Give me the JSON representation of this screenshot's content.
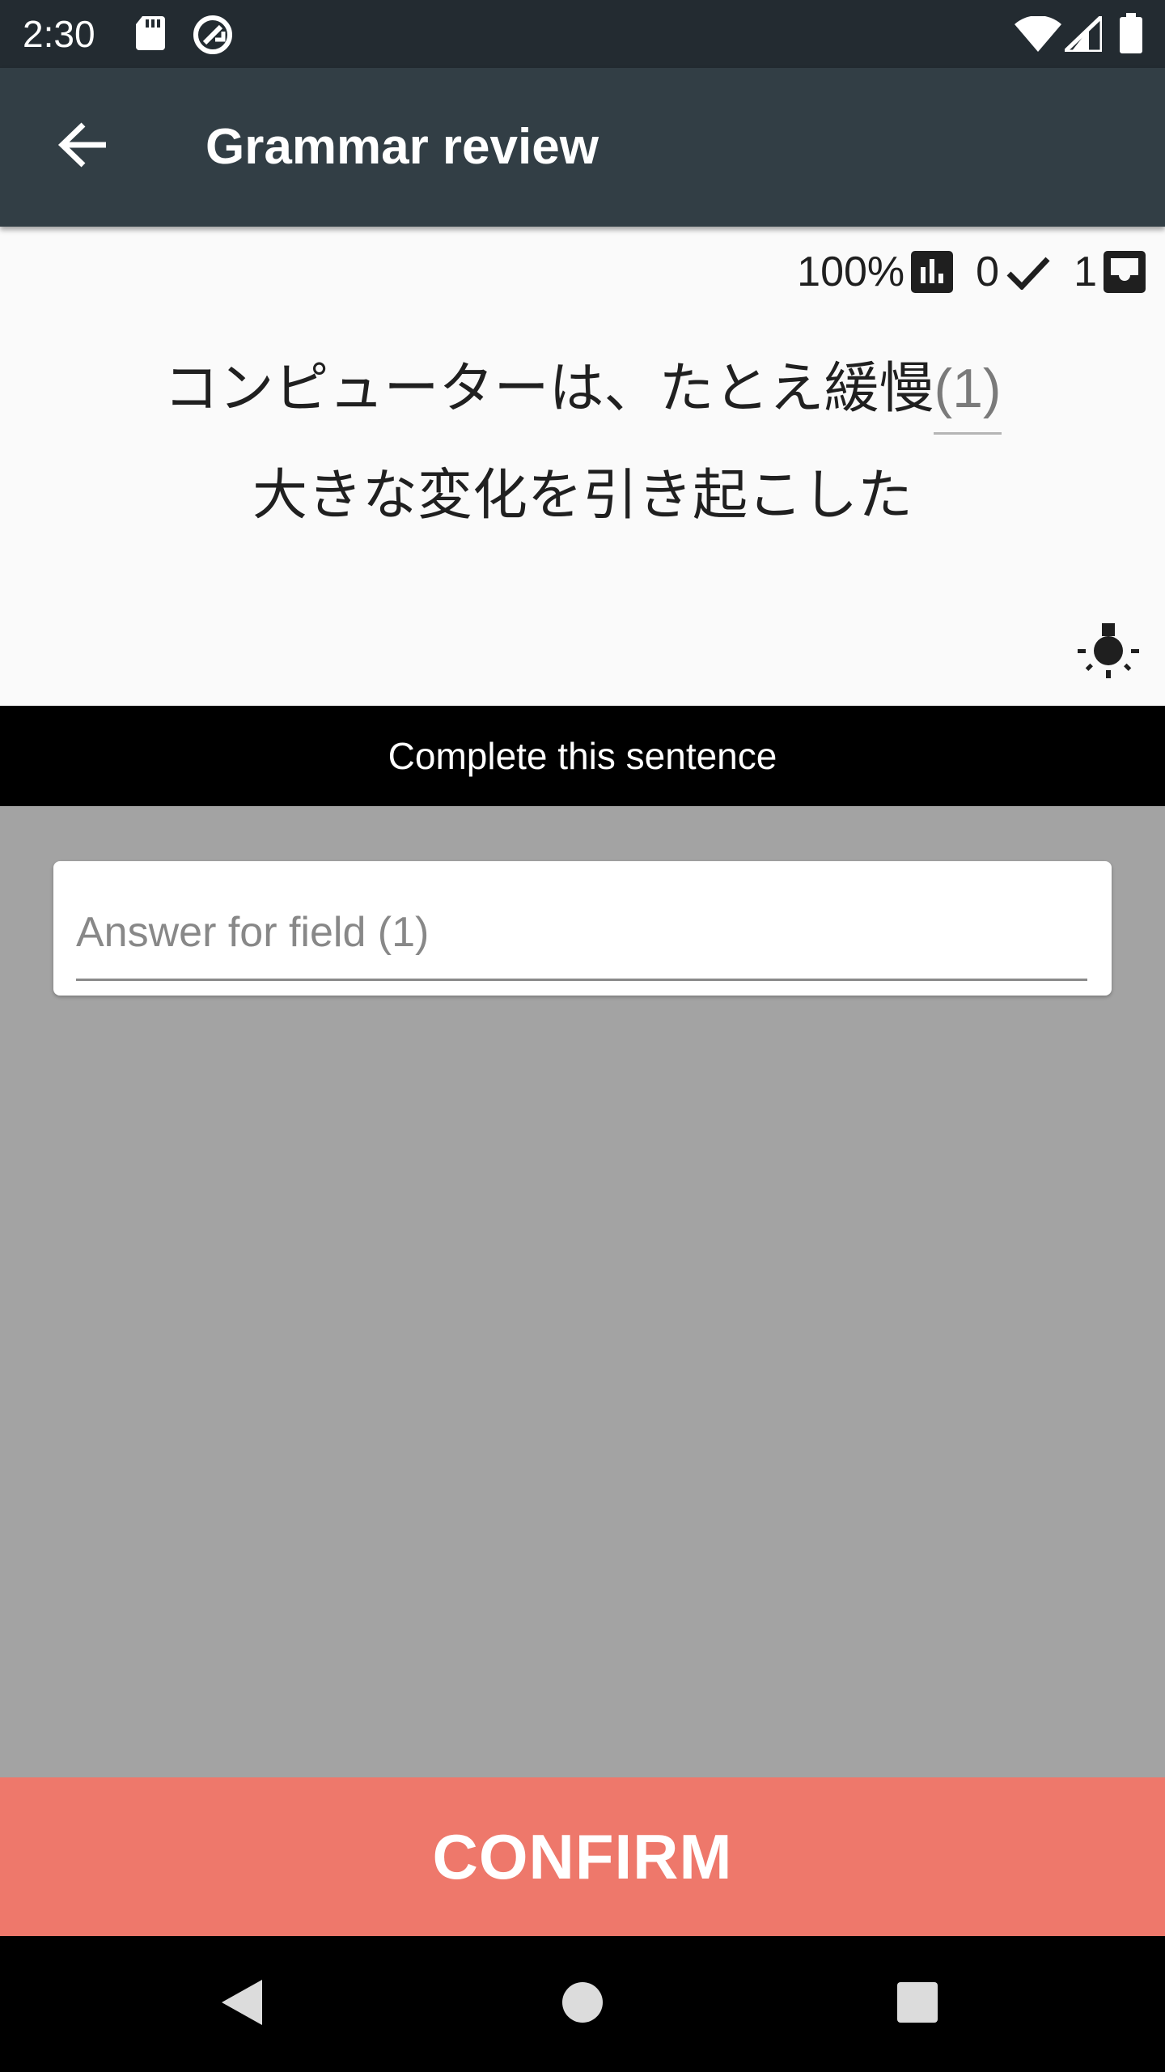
{
  "status_bar": {
    "time": "2:30",
    "icons": [
      "sd-card-icon",
      "sync-icon",
      "wifi-icon",
      "signal-icon",
      "battery-icon"
    ]
  },
  "app_bar": {
    "title": "Grammar review",
    "back_icon": "arrow-back-icon"
  },
  "stats": {
    "accuracy": "100%",
    "correct_count": "0",
    "remaining_count": "1"
  },
  "question": {
    "line1_text": "コンピューターは、たとえ緩慢",
    "blank_label": "(1)",
    "line2_text": "大きな変化を引き起こした"
  },
  "instruction": {
    "text": "Complete this sentence"
  },
  "answer": {
    "value": "",
    "placeholder": "Answer for field (1)"
  },
  "confirm": {
    "label": "CONFIRM"
  },
  "colors": {
    "status_bar": "#232b31",
    "app_bar": "#323e45",
    "question_bg": "#fafafa",
    "answer_area_bg": "#a3a3a3",
    "confirm_bg": "#ee786b"
  }
}
